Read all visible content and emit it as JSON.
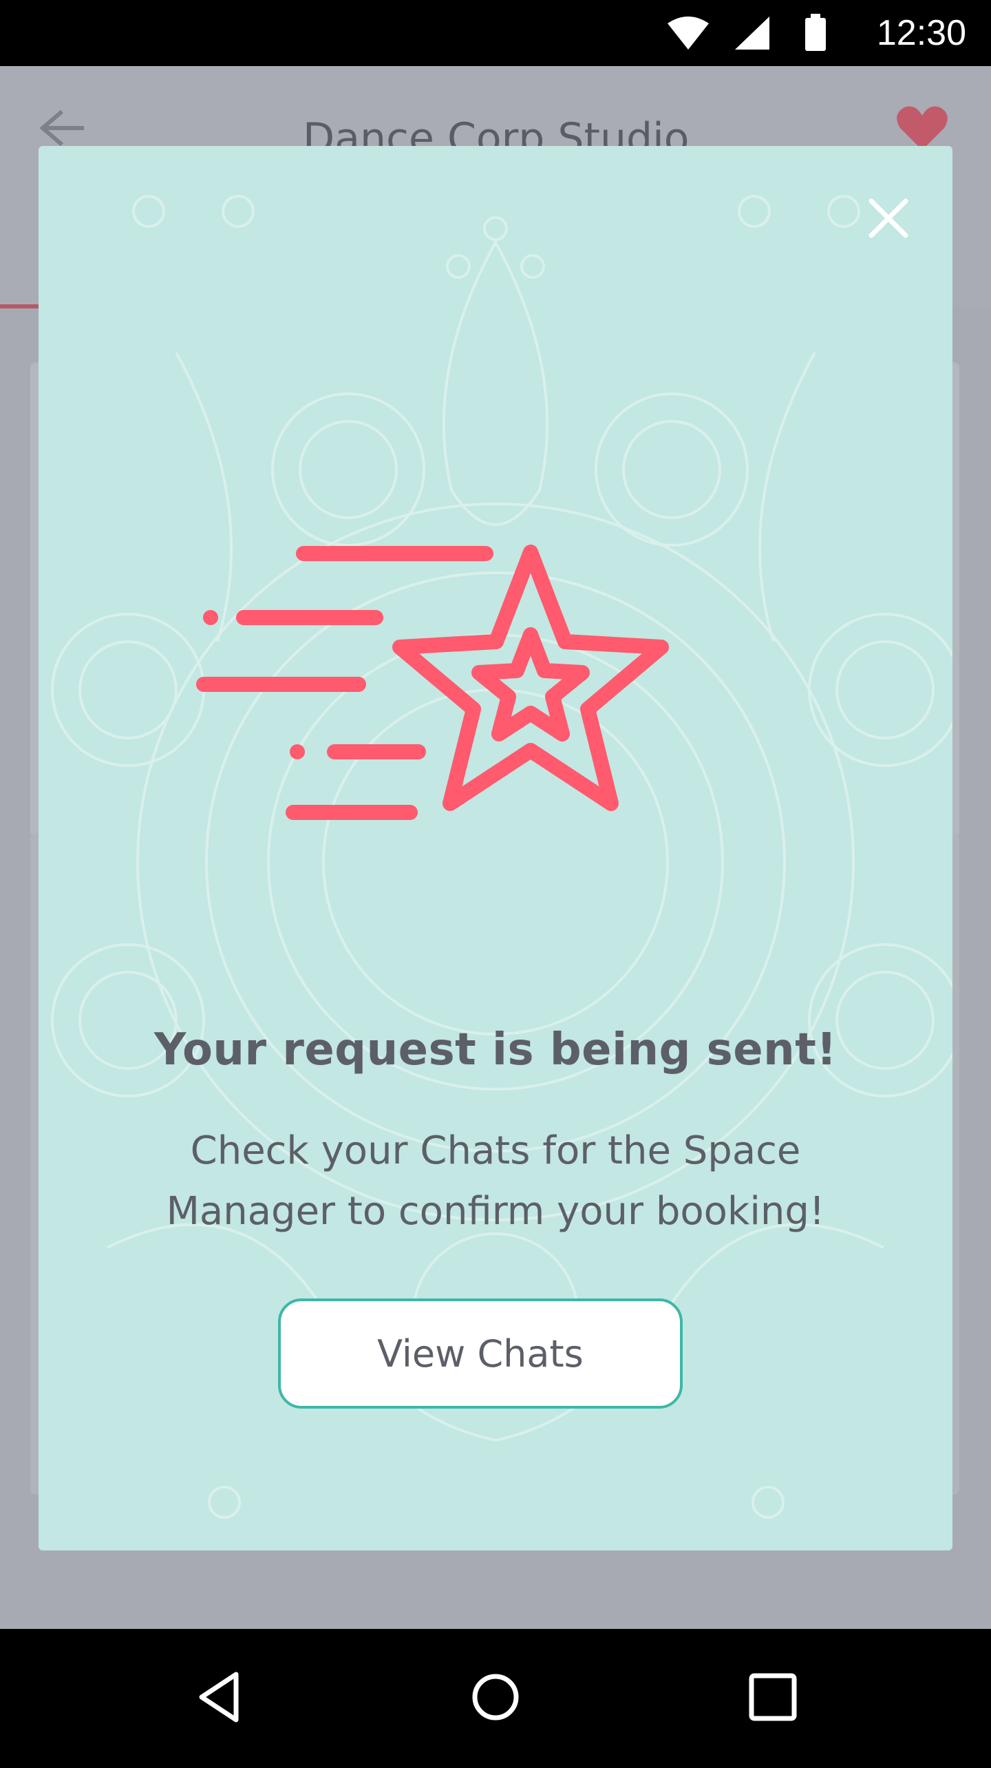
{
  "status_bar": {
    "time": "12:30",
    "icons": [
      "wifi-icon",
      "signal-icon",
      "battery-icon"
    ]
  },
  "background_screen": {
    "title": "Dance Corp Studio",
    "back_icon": "arrow-left-icon",
    "favorite_icon": "heart-icon",
    "bottom_nav": [
      "heart-icon",
      "search-icon",
      "person-icon",
      "menu-icon"
    ]
  },
  "modal": {
    "title": "Your request is being sent!",
    "message": "Check your Chats for the Space Manager to confirm your booking!",
    "button_label": "View Chats",
    "close_icon": "close-icon",
    "hero_icon": "shooting-star-icon"
  },
  "system_nav": [
    "back-icon",
    "home-icon",
    "recents-icon"
  ],
  "colors": {
    "accent": "#ff5a6e",
    "modal_bg": "#c3e7e2",
    "button_border": "#3db7a8",
    "text": "#5c5f68"
  }
}
